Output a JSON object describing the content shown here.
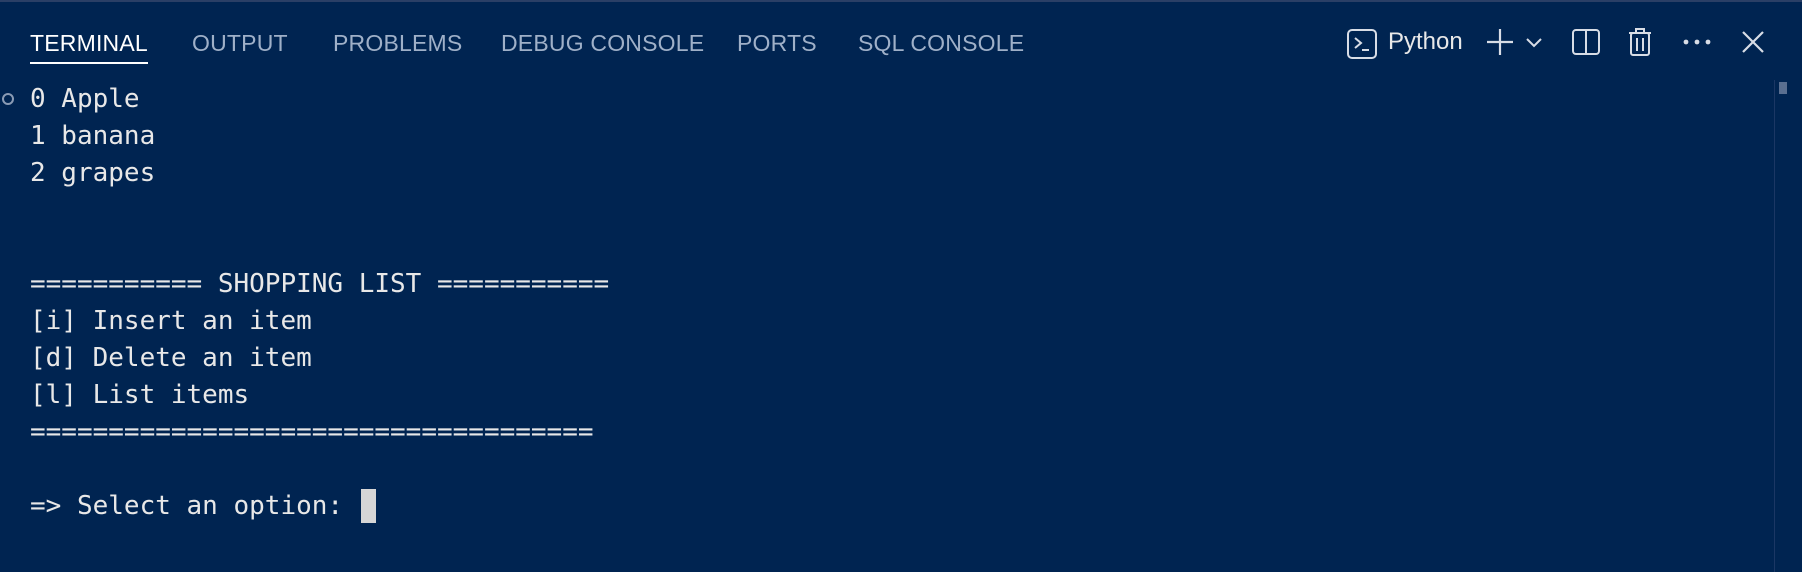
{
  "tabs": [
    {
      "label": "TERMINAL",
      "active": true
    },
    {
      "label": "OUTPUT",
      "active": false
    },
    {
      "label": "PROBLEMS",
      "active": false
    },
    {
      "label": "DEBUG CONSOLE",
      "active": false
    },
    {
      "label": "PORTS",
      "active": false
    },
    {
      "label": "SQL CONSOLE",
      "active": false
    }
  ],
  "toolbar": {
    "shell_name": "Python",
    "icons": {
      "shell": "terminal-prompt-icon",
      "new": "plus-icon",
      "dropdown": "chevron-down-icon",
      "split": "split-pane-icon",
      "kill": "trash-icon",
      "more": "ellipsis-icon",
      "close": "close-icon"
    }
  },
  "terminal": {
    "lines": [
      "0 Apple",
      "1 banana",
      "2 grapes",
      "",
      "",
      "=========== SHOPPING LIST ===========",
      "[i] Insert an item",
      "[d] Delete an item",
      "[l] List items",
      "====================================",
      "",
      "=> Select an option: "
    ]
  },
  "colors": {
    "background": "#002451",
    "text": "#e8e8e8",
    "inactive_tab": "#9fb0c8",
    "cursor": "#d6d6d6"
  }
}
